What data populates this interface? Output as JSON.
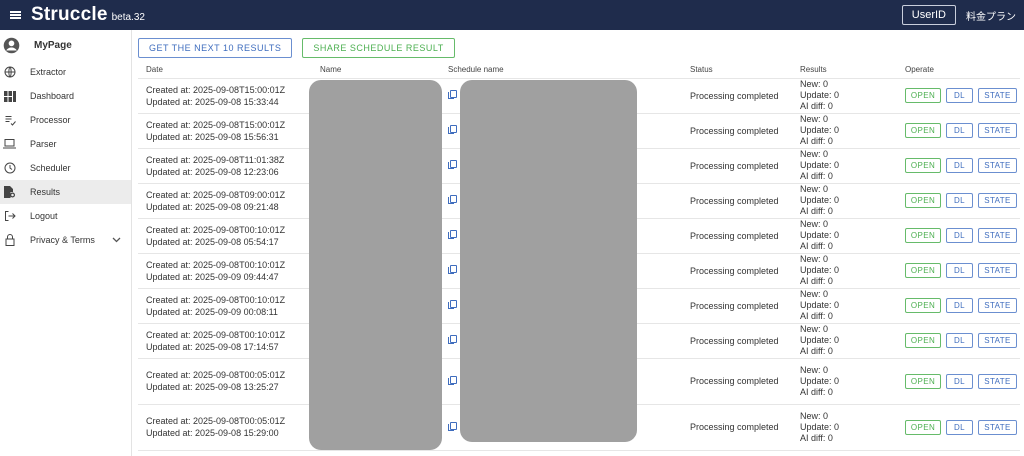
{
  "topbar": {
    "brand": "Struccle",
    "version": "beta.32",
    "userid_label": "UserID",
    "pricing_label": "料金プラン"
  },
  "sidebar": {
    "items": [
      {
        "label": "MyPage",
        "icon": "account-circle-icon"
      },
      {
        "label": "Extractor",
        "icon": "globe-icon"
      },
      {
        "label": "Dashboard",
        "icon": "dashboard-icon"
      },
      {
        "label": "Processor",
        "icon": "processor-icon"
      },
      {
        "label": "Parser",
        "icon": "laptop-icon"
      },
      {
        "label": "Scheduler",
        "icon": "clock-icon"
      },
      {
        "label": "Results",
        "icon": "results-icon",
        "active": true
      },
      {
        "label": "Logout",
        "icon": "logout-icon"
      },
      {
        "label": "Privacy & Terms",
        "icon": "lock-icon",
        "expandable": true
      }
    ]
  },
  "actions": {
    "next_label": "GET THE NEXT 10 RESULTS",
    "share_label": "SHARE SCHEDULE RESULT"
  },
  "table": {
    "headers": {
      "date": "Date",
      "name": "Name",
      "schedule": "Schedule name",
      "status": "Status",
      "results": "Results",
      "operate": "Operate"
    },
    "rows": [
      {
        "created": "Created at: 2025-09-08T15:00:01Z",
        "updated": "Updated at: 2025-09-08 15:33:44",
        "status": "Processing completed",
        "new": "New: 0",
        "update": "Update: 0",
        "ai": "AI diff: 0"
      },
      {
        "created": "Created at: 2025-09-08T15:00:01Z",
        "updated": "Updated at: 2025-09-08 15:56:31",
        "status": "Processing completed",
        "new": "New: 0",
        "update": "Update: 0",
        "ai": "AI diff: 0"
      },
      {
        "created": "Created at: 2025-09-08T11:01:38Z",
        "updated": "Updated at: 2025-09-08 12:23:06",
        "status": "Processing completed",
        "new": "New: 0",
        "update": "Update: 0",
        "ai": "AI diff: 0"
      },
      {
        "created": "Created at: 2025-09-08T09:00:01Z",
        "updated": "Updated at: 2025-09-08 09:21:48",
        "status": "Processing completed",
        "new": "New: 0",
        "update": "Update: 0",
        "ai": "AI diff: 0"
      },
      {
        "created": "Created at: 2025-09-08T00:10:01Z",
        "updated": "Updated at: 2025-09-08 05:54:17",
        "status": "Processing completed",
        "new": "New: 0",
        "update": "Update: 0",
        "ai": "AI diff: 0"
      },
      {
        "created": "Created at: 2025-09-08T00:10:01Z",
        "updated": "Updated at: 2025-09-09 09:44:47",
        "status": "Processing completed",
        "new": "New: 0",
        "update": "Update: 0",
        "ai": "AI diff: 0"
      },
      {
        "created": "Created at: 2025-09-08T00:10:01Z",
        "updated": "Updated at: 2025-09-09 00:08:11",
        "status": "Processing completed",
        "new": "New: 0",
        "update": "Update: 0",
        "ai": "AI diff: 0"
      },
      {
        "created": "Created at: 2025-09-08T00:10:01Z",
        "updated": "Updated at: 2025-09-08 17:14:57",
        "status": "Processing completed",
        "new": "New: 0",
        "update": "Update: 0",
        "ai": "AI diff: 0"
      },
      {
        "created": "Created at: 2025-09-08T00:05:01Z",
        "updated": "Updated at: 2025-09-08 13:25:27",
        "status": "Processing completed",
        "new": "New: 0",
        "update": "Update: 0",
        "ai": "AI diff: 0"
      },
      {
        "created": "Created at: 2025-09-08T00:05:01Z",
        "updated": "Updated at: 2025-09-08 15:29:00",
        "status": "Processing completed",
        "new": "New: 0",
        "update": "Update: 0",
        "ai": "AI diff: 0"
      }
    ],
    "operate": {
      "open": "OPEN",
      "dl": "DL",
      "state": "STATE"
    }
  },
  "colors": {
    "topbar": "#1f2c4c",
    "accent_blue": "#3f6dbe",
    "accent_green": "#4caf50",
    "redaction": "#a0a0a0"
  }
}
